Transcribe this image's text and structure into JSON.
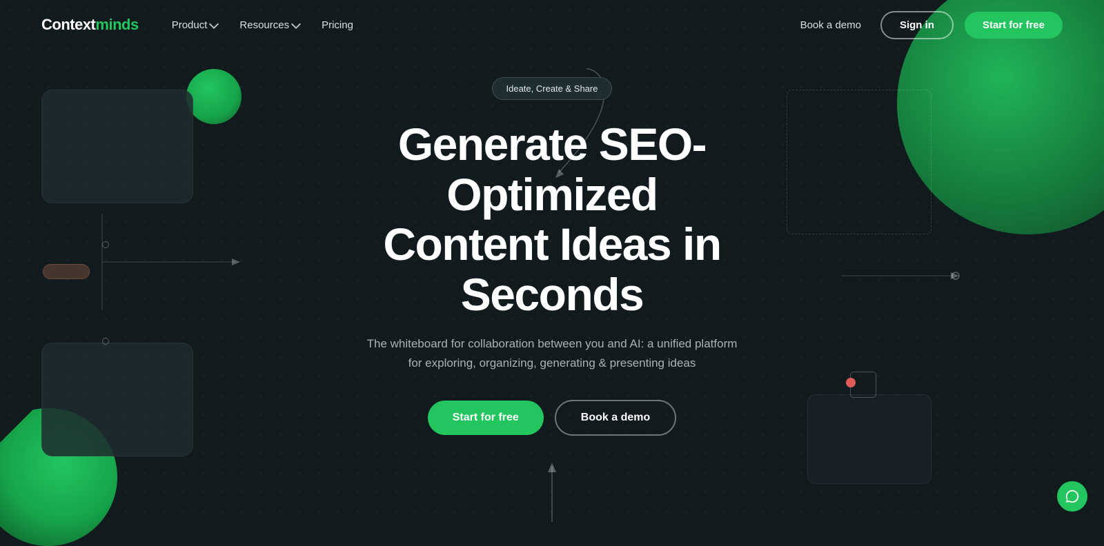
{
  "logo": {
    "context": "Context",
    "minds": "minds"
  },
  "nav": {
    "links": [
      {
        "label": "Product",
        "has_dropdown": true
      },
      {
        "label": "Resources",
        "has_dropdown": true
      },
      {
        "label": "Pricing",
        "has_dropdown": false
      }
    ],
    "book_demo": "Book a demo",
    "sign_in": "Sign in",
    "start_free": "Start for free"
  },
  "hero": {
    "badge": "Ideate, Create & Share",
    "title_line1": "Generate SEO-Optimized",
    "title_line2": "Content Ideas in Seconds",
    "subtitle": "The whiteboard for collaboration between you and AI: a unified platform for exploring, organizing, generating & presenting ideas",
    "cta_primary": "Start for free",
    "cta_secondary": "Book a demo"
  }
}
